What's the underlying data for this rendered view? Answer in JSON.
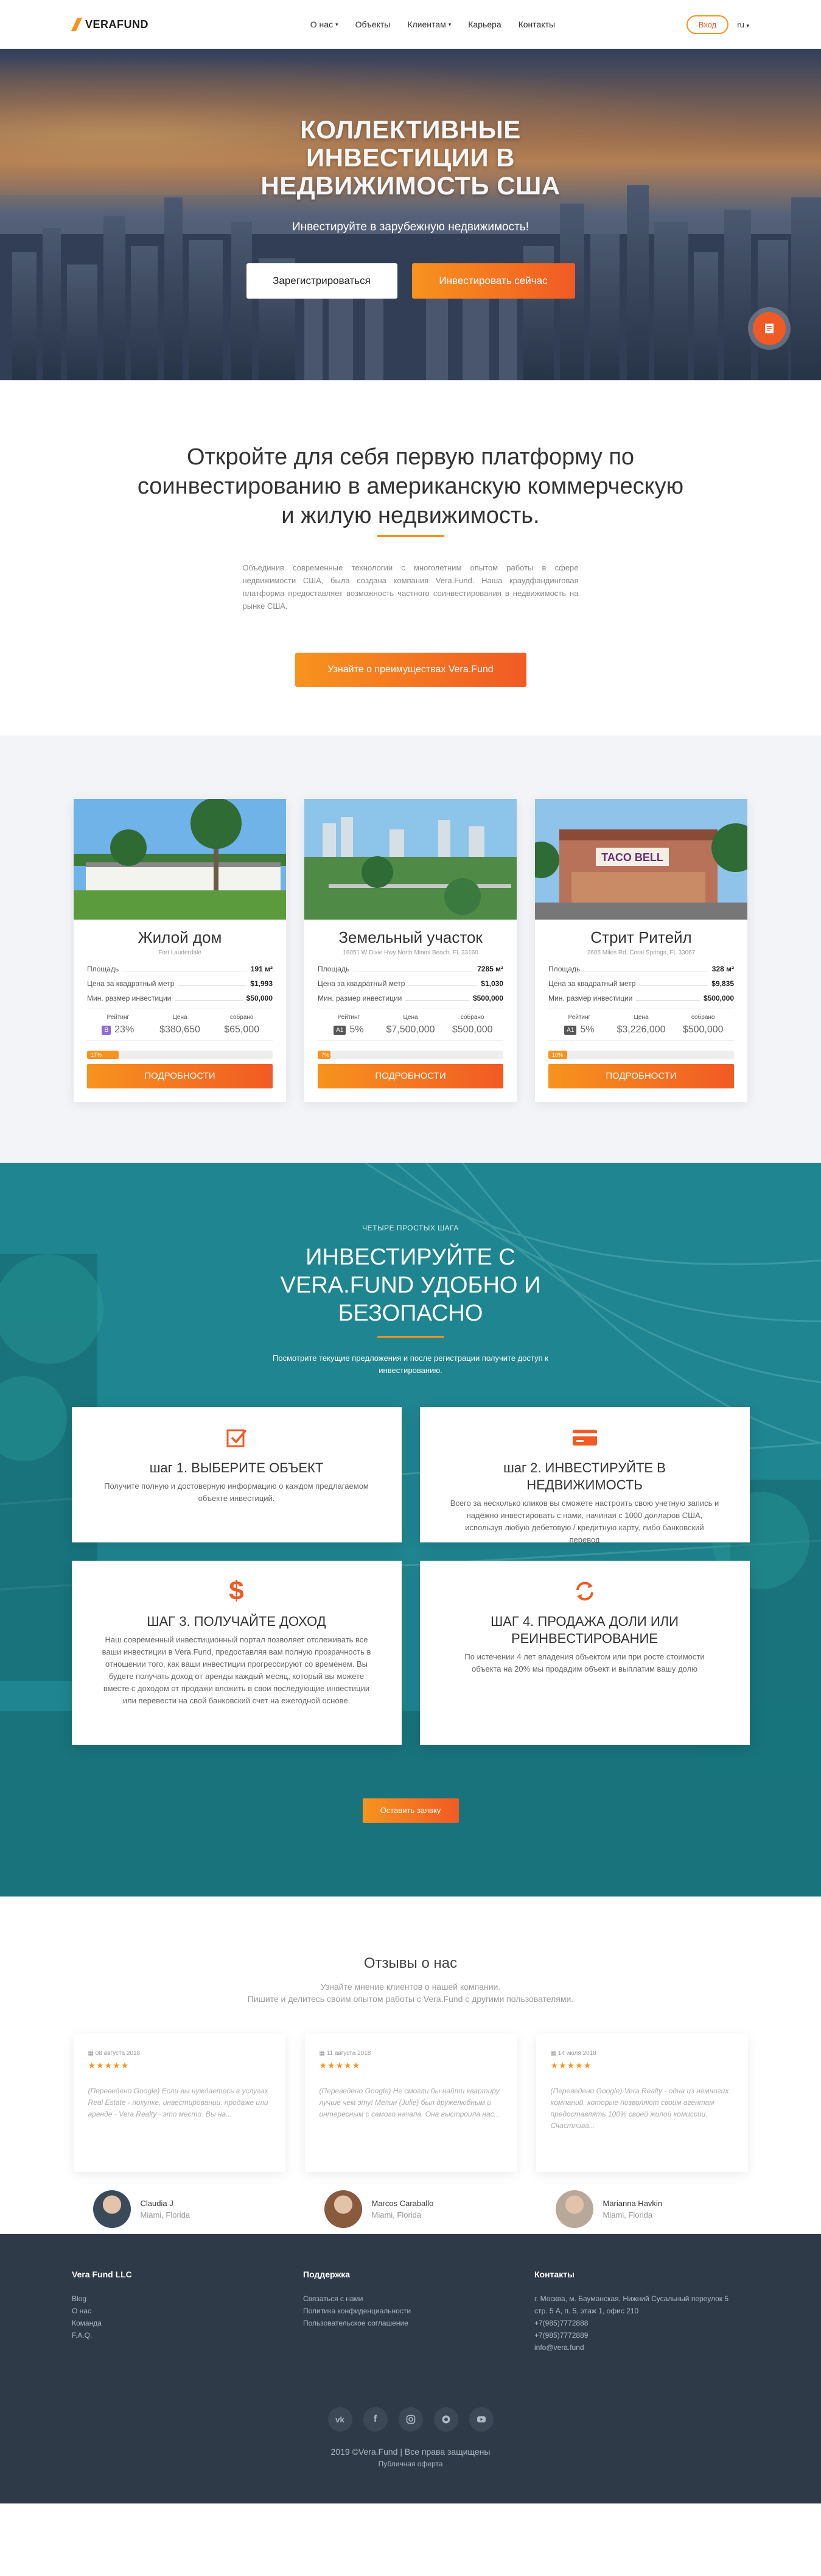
{
  "header": {
    "logo": "VERAFUND",
    "nav": [
      "О нас",
      "Объекты",
      "Клиентам",
      "Карьера",
      "Контакты"
    ],
    "login": "Вход",
    "lang": "ru"
  },
  "hero": {
    "title": "КОЛЛЕКТИВНЫЕ ИНВЕСТИЦИИ В НЕДВИЖИМОСТЬ США",
    "subtitle": "Инвестируйте в зарубежную недвижимость!",
    "register": "Зарегистрироваться",
    "invest": "Инвестировать сейчас"
  },
  "intro": {
    "heading": "Откройте для себя первую платформу по соинвестированию в американскую коммерческую и жилую недвижимость.",
    "text": "Объединив современные технологии с многолетним опытом работы в сфере недвижимости США, была создана компания Vera.Fund. Наша краудфандинговая платформа предоставляет возможность частного соинвестирования в недвижимость на рынке США.",
    "button": "Узнайте о преимуществах Vera.Fund"
  },
  "labels": {
    "area": "Площадь",
    "price_sqm": "Цена за квадратный метр",
    "min_invest": "Мин. размер инвестиции",
    "rating": "Рейтинг",
    "price": "Цена",
    "collected": "собрано",
    "details": "ПОДРОБНОСТИ"
  },
  "properties": [
    {
      "title": "Жилой дом",
      "address": "Fort Lauderdale",
      "area": "191 м²",
      "price_sqm": "$1,993",
      "min": "$50,000",
      "rating": "B",
      "rating_pct": "23%",
      "price": "$380,650",
      "collected": "$65,000",
      "progress": 0.17,
      "progress_label": "17%",
      "rating_color": "#8e6ad8"
    },
    {
      "title": "Земельный участок",
      "address": "16051 W Dixie Hwy North Miami Beach, FL 33160",
      "area": "7285 м²",
      "price_sqm": "$1,030",
      "min": "$500,000",
      "rating": "A1",
      "rating_pct": "5%",
      "price": "$7,500,000",
      "collected": "$500,000",
      "progress": 0.07,
      "progress_label": "7%",
      "rating_color": "#555555"
    },
    {
      "title": "Стрит Ритейл",
      "address": "2605 Miles Rd, Coral Springs, FL 33067",
      "area": "328 м²",
      "price_sqm": "$9,835",
      "min": "$500,000",
      "rating": "A1",
      "rating_pct": "5%",
      "price": "$3,226,000",
      "collected": "$500,000",
      "progress": 0.1,
      "progress_label": "10%",
      "rating_color": "#555555"
    }
  ],
  "steps": {
    "small": "ЧЕТЫРЕ ПРОСТЫХ ШАГА",
    "title": "ИНВЕСТИРУЙТЕ С VERA.FUND УДОБНО И БЕЗОПАСНО",
    "text": "Посмотрите текущие предложения и после регистрации получите доступ к инвестированию.",
    "items": [
      {
        "title": "шаг 1. ВЫБЕРИТЕ ОБЪЕКТ",
        "text": "Получите полную и достоверную информацию о каждом предлагаемом объекте инвестиций.",
        "icon": "checkbox-icon"
      },
      {
        "title": "шаг 2. ИНВЕСТИРУЙТЕ В НЕДВИЖИМОСТЬ",
        "text": "Всего за несколько кликов вы сможете настроить свою учетную запись и надежно инвестировать с нами, начиная с 1000 долларов США, используя любую дебетовую / кредитную карту, либо банковский перевод",
        "icon": "credit-card-icon"
      },
      {
        "title": "ШАГ 3. ПОЛУЧАЙТЕ ДОХОД",
        "text": "Наш современный инвестиционный портал позволяет отслеживать все ваши инвестиции в Vera.Fund, предоставляя вам полную прозрачность в отношении того, как ваши инвестиции прогрессируют со временем. Вы будете получать доход от аренды каждый месяц, который вы можете вместе с доходом от продажи вложить в свои последующие инвестиции или перевести на свой банковский счет на ежегодной основе.",
        "icon": "dollar-icon"
      },
      {
        "title": "ШАГ 4. ПРОДАЖА ДОЛИ ИЛИ РЕИНВЕСТИРОВАНИЕ",
        "text": "По истечении 4 лет владения объектом или при росте стоимости объекта на 20% мы продадим объект и выплатим вашу долю",
        "icon": "refresh-icon"
      }
    ],
    "button": "Оставить заявку"
  },
  "reviews": {
    "title": "Отзывы о нас",
    "sub1": "Узнайте мнение клиентов о нашей компании.",
    "sub2": "Пишите и делитесь своим опытом работы с Vera.Fund с другими пользователями.",
    "items": [
      {
        "date": "08 августа 2018",
        "text": "(Переведено Google) Если вы нуждаетесь в услугах Real Estate - покупке, инвестировании, продаже или аренде - Vera Realty - это место. Вы на...",
        "name": "Claudia J",
        "city": "Miami, Florida"
      },
      {
        "date": "11 августа 2018",
        "text": "(Переведено Google) Не смогли бы найти квартиру лучше чем эту! Мелин (Julie) был дружелюбным и интересным с самого начала. Она выстроила нас...",
        "name": "Marcos Caraballo",
        "city": "Miami, Florida"
      },
      {
        "date": "14 июля 2018",
        "text": "(Переведено Google) Vera Realty - одна из немногих компаний, которые позволяют своим агентам предоставлять 100% своей жилой комиссии. Счастлива...",
        "name": "Marianna Havkin",
        "city": "Miami, Florida"
      }
    ]
  },
  "footer": {
    "col1_title": "Vera Fund LLC",
    "col1": [
      "Blog",
      "О нас",
      "Команда",
      "F.A.Q."
    ],
    "col2_title": "Поддержка",
    "col2": [
      "Связаться с нами",
      "Политика конфиденциальности",
      "Пользовательское соглашение"
    ],
    "col3_title": "Контакты",
    "col3": [
      "г. Москва, м. Бауманская, Нижний Сусальный переулок 5 стр. 5 А, п. 5, этаж 1, офис 210",
      "+7(985)7772888",
      "+7(985)7772889",
      "info@vera.fund"
    ],
    "copyright": "2019 ©Vera.Fund  |  Все права защищены",
    "offer": "Публичная оферта"
  },
  "colors": {
    "accent": "#f7931e",
    "accent2": "#f15a24",
    "footer": "#2e3a47",
    "teal": "#218893"
  }
}
